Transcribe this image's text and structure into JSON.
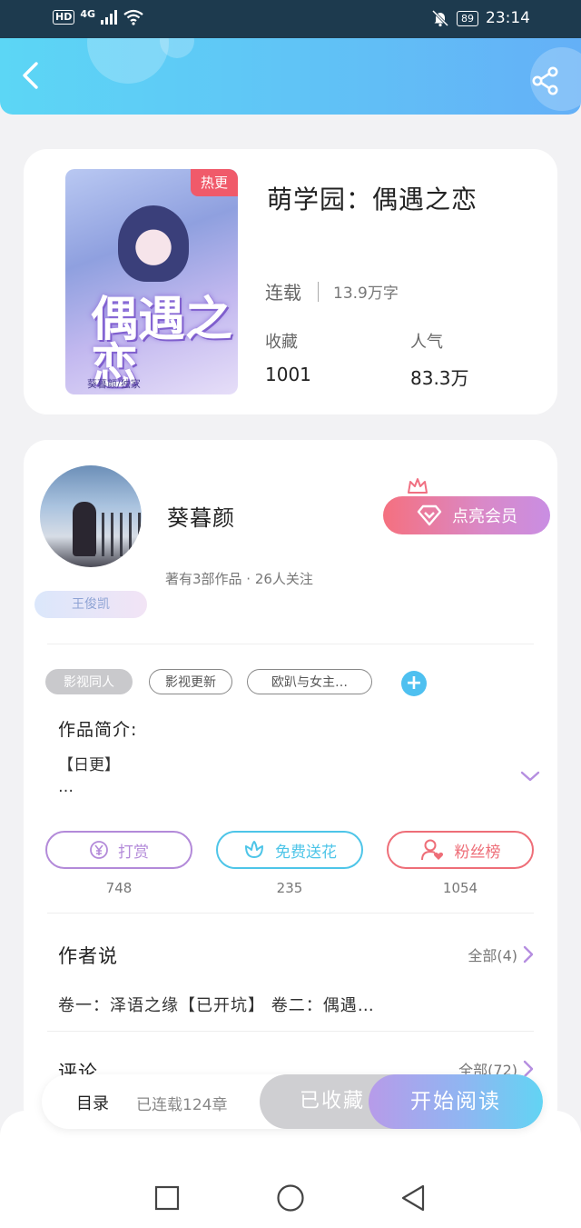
{
  "status_bar": {
    "network": "4G",
    "hd": "HD",
    "battery": "89",
    "time": "23:14"
  },
  "book": {
    "title": "萌学园：偶遇之恋",
    "hot_badge": "热更",
    "cover_title": "偶遇之恋",
    "cover_author": "葵暮颜/独家",
    "status": "连载",
    "word_count": "13.9万字",
    "fav_label": "收藏",
    "fav_value": "1001",
    "pop_label": "人气",
    "pop_value": "83.3万"
  },
  "author": {
    "name": "葵暮颜",
    "meta": "著有3部作品 · 26人关注",
    "fan_badge": "王俊凯",
    "vip_button": "点亮会员"
  },
  "tags": [
    "影视同人",
    "影视更新",
    "欧趴与女主…"
  ],
  "intro": {
    "label": "作品简介:",
    "text": "【日更】\n…"
  },
  "actions": [
    {
      "label": "打赏",
      "count": "748",
      "color": "#b38ad9"
    },
    {
      "label": "免费送花",
      "count": "235",
      "color": "#4ec5e8"
    },
    {
      "label": "粉丝榜",
      "count": "1054",
      "color": "#ee6e78"
    }
  ],
  "author_say": {
    "title": "作者说",
    "more": "全部(4)",
    "text": "卷一：泽语之缘【已开坑】 卷二：偶遇…"
  },
  "comments": {
    "title": "评论",
    "more": "全部(72)"
  },
  "bottom_bar": {
    "catalog": "目录",
    "chapters": "已连载124章",
    "favorited": "已收藏",
    "start_reading": "开始阅读"
  }
}
